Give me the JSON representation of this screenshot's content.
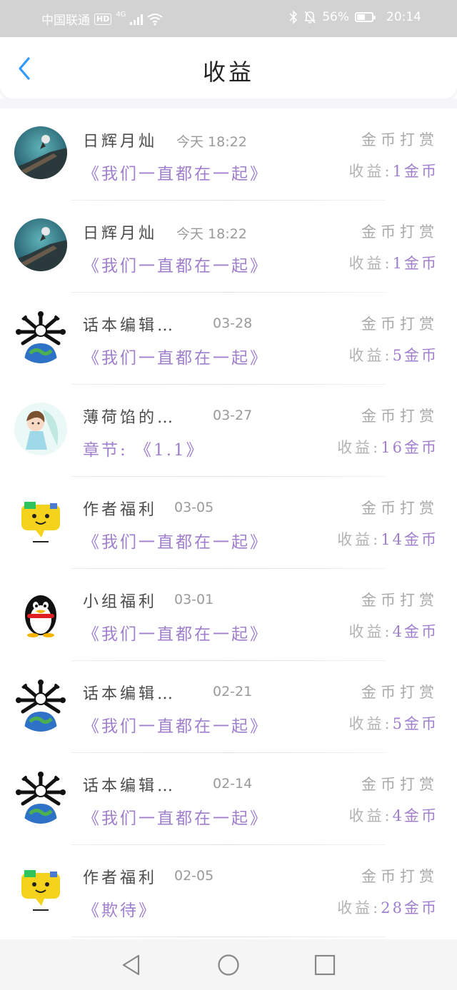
{
  "status_bar": {
    "carrier": "中国联通",
    "hd": "HD",
    "network": "4G",
    "battery": "56%",
    "battery_level": 0.56,
    "time": "20:14",
    "icons": [
      "signal-icon",
      "wifi-icon",
      "bluetooth-icon",
      "mute-bell-icon",
      "battery-icon"
    ]
  },
  "header": {
    "title": "收益",
    "back_icon": "chevron-left-icon"
  },
  "colors": {
    "accent": "#a07fcc",
    "back": "#2f9bff",
    "muted": "#a9a9a9"
  },
  "records": [
    {
      "avatar": "ocean-rock",
      "name": "日辉月灿",
      "time": "今天 18:22",
      "type": "金币打赏",
      "work": "《我们一直都在一起》",
      "income_label": "收益:",
      "income_value": "1金币"
    },
    {
      "avatar": "ocean-rock",
      "name": "日辉月灿",
      "time": "今天 18:22",
      "type": "金币打赏",
      "work": "《我们一直都在一起》",
      "income_label": "收益:",
      "income_value": "1金币"
    },
    {
      "avatar": "earth-spikes",
      "name": "话本编辑…",
      "time": "03-28",
      "type": "金币打赏",
      "work": "《我们一直都在一起》",
      "income_label": "收益:",
      "income_value": "5金币"
    },
    {
      "avatar": "anime-girl",
      "name": "薄荷馅的…",
      "time": "03-27",
      "type": "金币打赏",
      "work": "章节: 《1.1》",
      "income_label": "收益:",
      "income_value": "16金币"
    },
    {
      "avatar": "yellow-chat",
      "name": "作者福利",
      "time": "03-05",
      "type": "金币打赏",
      "work": "《我们一直都在一起》",
      "income_label": "收益:",
      "income_value": "14金币"
    },
    {
      "avatar": "penguin",
      "name": "小组福利",
      "time": "03-01",
      "type": "金币打赏",
      "work": "《我们一直都在一起》",
      "income_label": "收益:",
      "income_value": "4金币"
    },
    {
      "avatar": "earth-spikes",
      "name": "话本编辑…",
      "time": "02-21",
      "type": "金币打赏",
      "work": "《我们一直都在一起》",
      "income_label": "收益:",
      "income_value": "5金币"
    },
    {
      "avatar": "earth-spikes",
      "name": "话本编辑…",
      "time": "02-14",
      "type": "金币打赏",
      "work": "《我们一直都在一起》",
      "income_label": "收益:",
      "income_value": "4金币"
    },
    {
      "avatar": "yellow-chat",
      "name": "作者福利",
      "time": "02-05",
      "type": "金币打赏",
      "work": "《欺待》",
      "income_label": "收益:",
      "income_value": "28金币"
    }
  ],
  "nav": {
    "icons": [
      "back-triangle-icon",
      "home-circle-icon",
      "recents-square-icon"
    ]
  }
}
